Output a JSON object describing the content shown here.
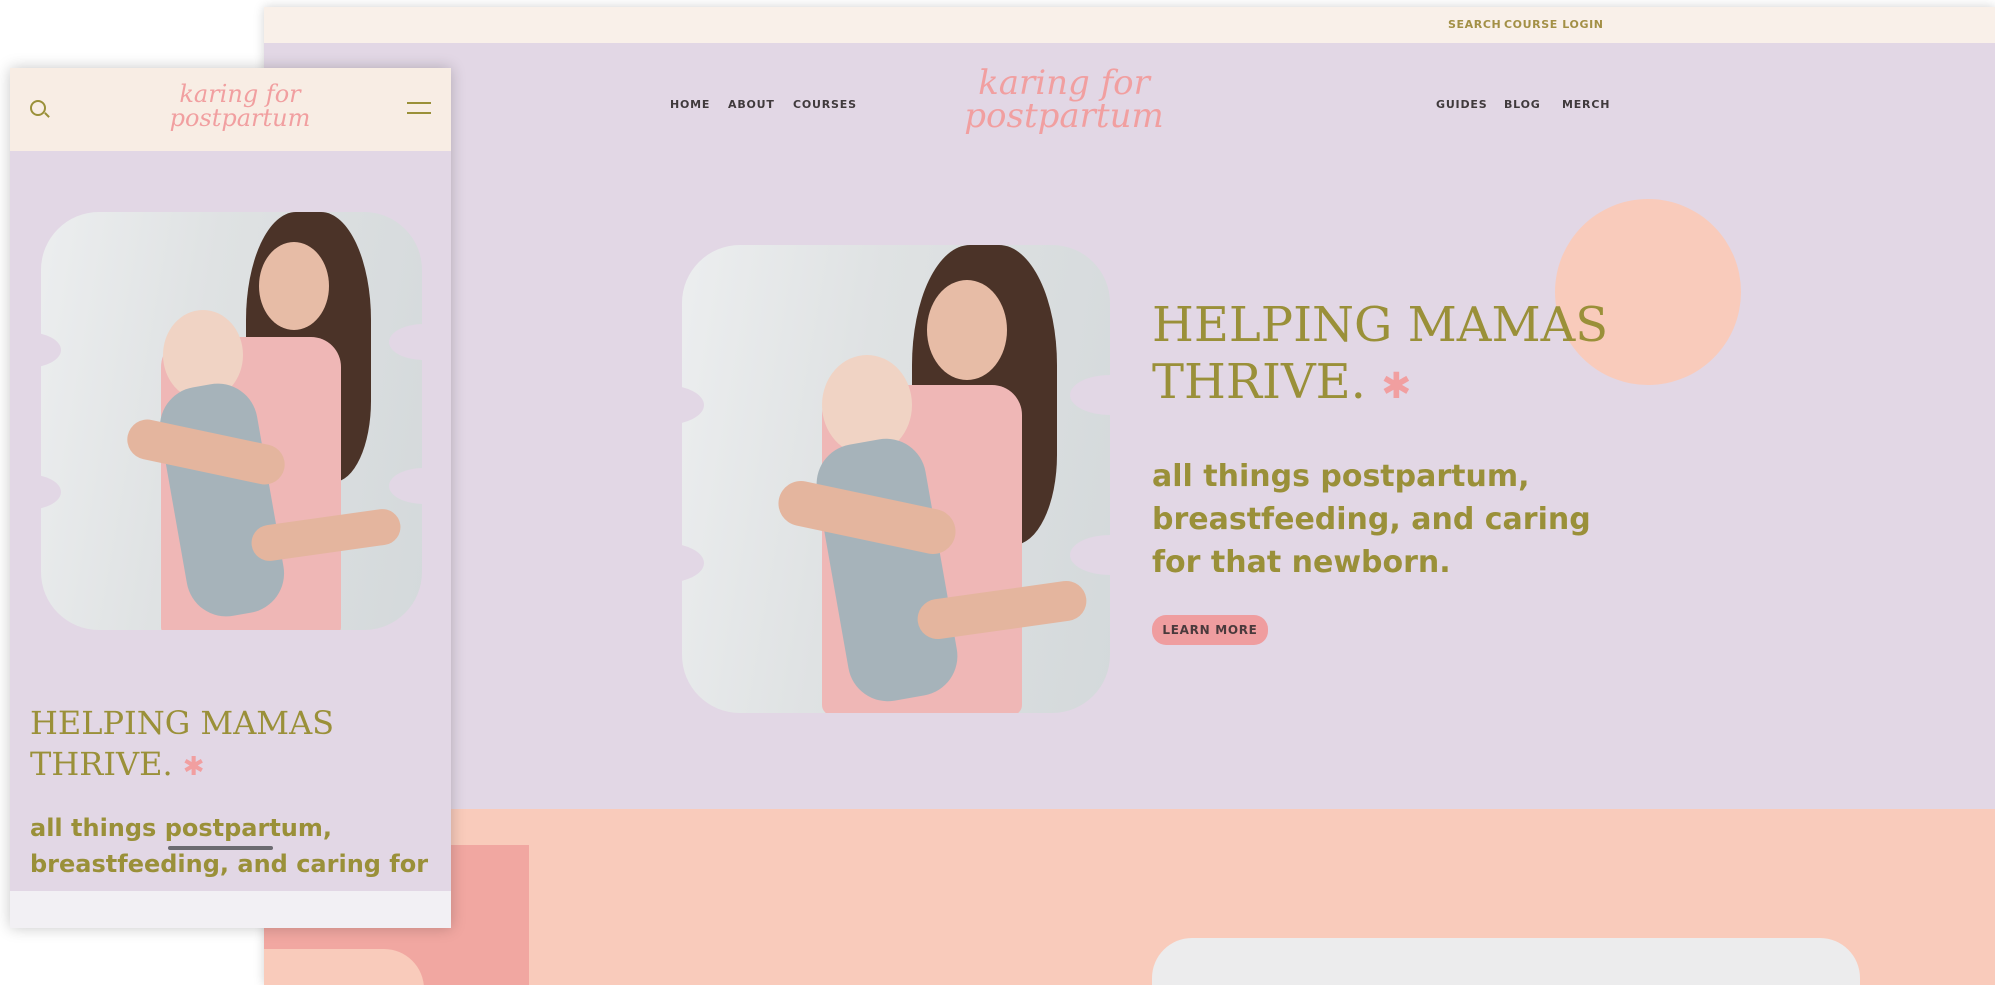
{
  "desktop": {
    "topbar": {
      "search": "SEARCH",
      "course_login": "COURSE LOGIN"
    },
    "nav_left": [
      "HOME",
      "ABOUT",
      "COURSES"
    ],
    "nav_right": [
      "GUIDES",
      "BLOG",
      "MERCH"
    ],
    "logo": {
      "line1": "karing for",
      "line2": "postpartum"
    },
    "hero": {
      "title_line1": "HELPING MAMAS",
      "title_line2": "THRIVE.",
      "asterisk": "✱",
      "subtitle_line1": "all things postpartum,",
      "subtitle_line2": "breastfeeding, and caring",
      "subtitle_line3": "for that newborn.",
      "button": "LEARN MORE"
    }
  },
  "mobile": {
    "logo": {
      "line1": "karing for",
      "line2": "postpartum"
    },
    "hero": {
      "title_line1": "HELPING MAMAS",
      "title_line2": "THRIVE.",
      "asterisk": "✱",
      "subtitle_line1": "all things postpartum,",
      "subtitle_line2": "breastfeeding, and caring for"
    }
  },
  "icons": {
    "search": "search-icon",
    "menu": "hamburger-menu-icon",
    "asterisk": "asterisk-icon"
  },
  "colors": {
    "lavender": "#e2d7e5",
    "olive": "#9a9039",
    "pink": "#f19fa0",
    "peach": "#f9cbbb",
    "cream": "#f9f0e9"
  }
}
